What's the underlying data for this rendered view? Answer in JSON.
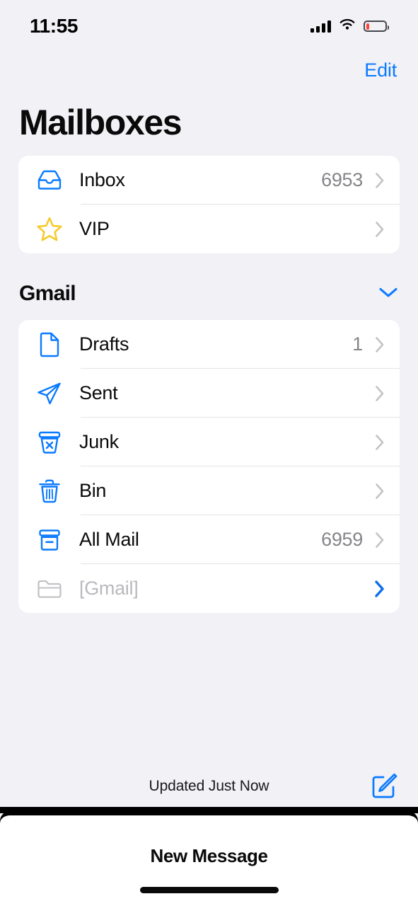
{
  "status_bar": {
    "time": "11:55",
    "cellular_icon": "cellular-bars-icon",
    "wifi_icon": "wifi-icon",
    "battery_icon": "battery-low-icon",
    "battery_color": "#FF3B30"
  },
  "nav": {
    "edit_label": "Edit",
    "accent_color": "#0A7AFF"
  },
  "header": {
    "title": "Mailboxes"
  },
  "main_card": {
    "rows": [
      {
        "icon": "inbox-tray-icon",
        "label": "Inbox",
        "count": "6953",
        "chevron": "chevron-right-icon",
        "chevron_style": "gray"
      },
      {
        "icon": "star-icon",
        "label": "VIP",
        "count": "",
        "chevron": "chevron-right-icon",
        "chevron_style": "gray"
      }
    ]
  },
  "gmail_section": {
    "title": "Gmail",
    "collapse_icon": "chevron-down-icon",
    "expanded": true,
    "rows": [
      {
        "icon": "document-icon",
        "label": "Drafts",
        "count": "1",
        "chevron": "chevron-right-icon",
        "chevron_style": "gray",
        "dim": false
      },
      {
        "icon": "paper-plane-icon",
        "label": "Sent",
        "count": "",
        "chevron": "chevron-right-icon",
        "chevron_style": "gray",
        "dim": false
      },
      {
        "icon": "junk-bin-icon",
        "label": "Junk",
        "count": "",
        "chevron": "chevron-right-icon",
        "chevron_style": "gray",
        "dim": false
      },
      {
        "icon": "trash-icon",
        "label": "Bin",
        "count": "",
        "chevron": "chevron-right-icon",
        "chevron_style": "gray",
        "dim": false
      },
      {
        "icon": "archive-box-icon",
        "label": "All Mail",
        "count": "6959",
        "chevron": "chevron-right-icon",
        "chevron_style": "gray",
        "dim": false
      },
      {
        "icon": "folder-icon",
        "label": "[Gmail]",
        "count": "",
        "chevron": "chevron-right-icon",
        "chevron_style": "blue",
        "dim": true
      }
    ]
  },
  "toolbar": {
    "status_text": "Updated Just Now",
    "compose_icon": "compose-icon"
  },
  "sheet": {
    "title": "New Message"
  },
  "colors": {
    "background": "#F1F1F6",
    "card": "#FFFFFF",
    "blue": "#0A7AFF",
    "star_yellow": "#F5CB2B",
    "dim_gray": "#B9B9BE"
  }
}
